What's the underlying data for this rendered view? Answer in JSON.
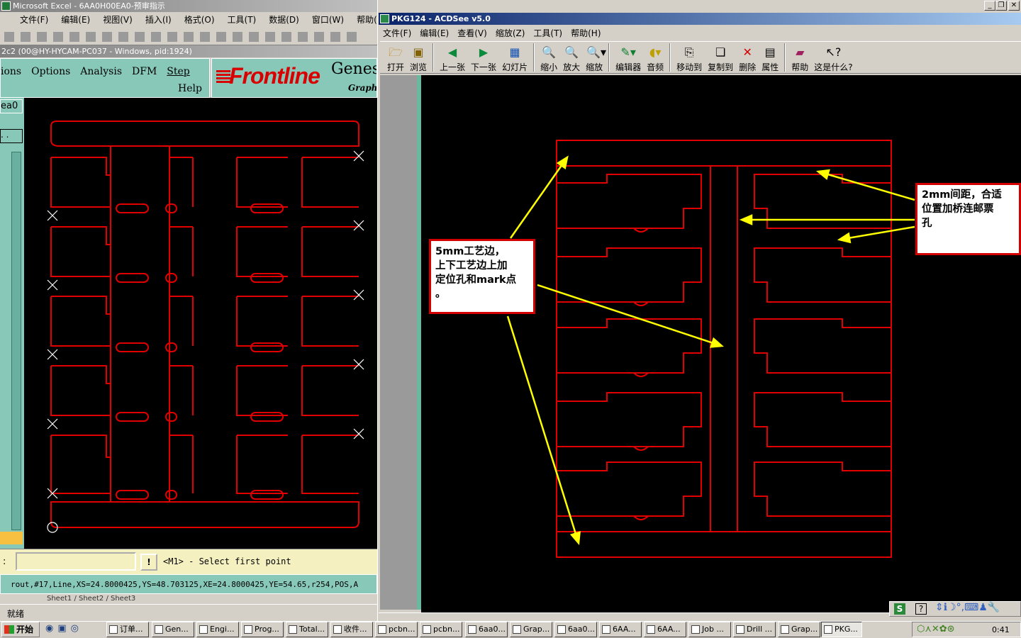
{
  "excel": {
    "title": "Microsoft Excel - 6AA0H00EA0-预审指示",
    "menu": [
      "文件(F)",
      "编辑(E)",
      "视图(V)",
      "插入(I)",
      "格式(O)",
      "工具(T)",
      "数据(D)",
      "窗口(W)",
      "帮助("
    ],
    "status": "就绪",
    "sheet_tabs": "Sheet1 / Sheet2 / Sheet3"
  },
  "genesis": {
    "title": "2c2 (00@HY-HYCAM-PC037 - Windows, pid:1924)",
    "menu": [
      "ions",
      "Options",
      "Analysis",
      "DFM",
      "Step"
    ],
    "help": "Help",
    "brand": "Frontline",
    "brand2": "Genes",
    "brand3": "Graph",
    "layer_label": "ea0",
    "input_label": ":",
    "prompt": "<M1> - Select first point",
    "info_line": "rout,#17,Line,XS=24.8000425,YS=48.703125,XE=24.8000425,YE=54.65,r254,POS,A"
  },
  "acdsee": {
    "title": "PKG124 - ACDSee v5.0",
    "menu": [
      "文件(F)",
      "编辑(E)",
      "查看(V)",
      "缩放(Z)",
      "工具(T)",
      "帮助(H)"
    ],
    "toolbar": [
      {
        "label": "打开",
        "icon": "open-folder-icon"
      },
      {
        "label": "浏览",
        "icon": "browse-icon"
      },
      {
        "label": "上一张",
        "icon": "prev-icon"
      },
      {
        "label": "下一张",
        "icon": "next-icon"
      },
      {
        "label": "幻灯片",
        "icon": "slideshow-icon"
      },
      {
        "label": "缩小",
        "icon": "zoom-out-icon"
      },
      {
        "label": "放大",
        "icon": "zoom-in-icon"
      },
      {
        "label": "缩放",
        "icon": "zoom-icon"
      },
      {
        "label": "编辑器",
        "icon": "editor-icon"
      },
      {
        "label": "音频",
        "icon": "audio-icon"
      },
      {
        "label": "移动到",
        "icon": "move-to-icon"
      },
      {
        "label": "复制到",
        "icon": "copy-to-icon"
      },
      {
        "label": "删除",
        "icon": "delete-icon"
      },
      {
        "label": "属性",
        "icon": "properties-icon"
      },
      {
        "label": "帮助",
        "icon": "help-book-icon"
      },
      {
        "label": "这是什么?",
        "icon": "whats-this-icon"
      }
    ],
    "callout_left": [
      "5mm工艺边，",
      "上下工艺边上加",
      "定位孔和mark点",
      "。"
    ],
    "callout_right": [
      "2mm间距，合适",
      "位置加桥连邮票",
      "孔"
    ]
  },
  "taskbar": {
    "start": "开始",
    "items": [
      "订单...",
      "Gen...",
      "Engi...",
      "Prog...",
      "Total...",
      "收件...",
      "pcbn...",
      "pcbn...",
      "6aa0...",
      "Grap...",
      "6aa0...",
      "6AA...",
      "6AA...",
      "Job ...",
      "Drill ...",
      "Grap...",
      "PKG..."
    ],
    "clock": "0:41"
  },
  "colors": {
    "outline": "#e00000",
    "arrow": "#ffff00",
    "callout_border": "#d40000",
    "genesis_bg": "#88c8b8"
  }
}
